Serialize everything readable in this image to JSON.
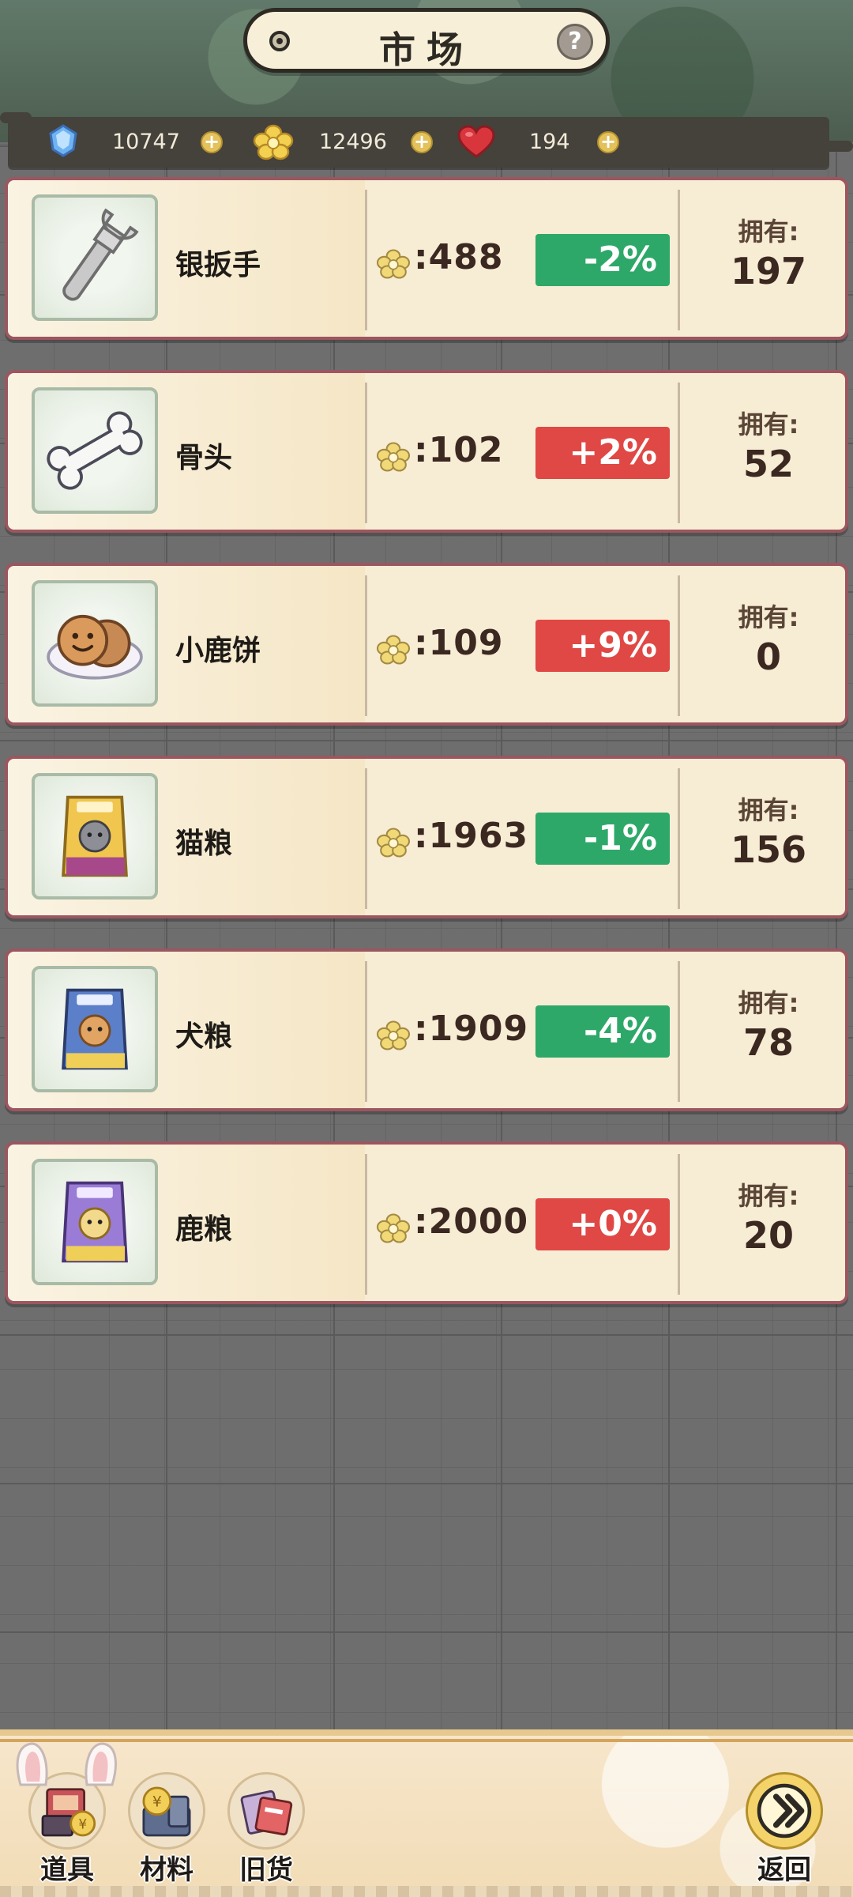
{
  "header": {
    "title": "市场",
    "help_label": "?"
  },
  "currencies": [
    {
      "icon": "blue-gem-icon",
      "value": "10747"
    },
    {
      "icon": "flower-coin-icon",
      "value": "12496"
    },
    {
      "icon": "heart-icon",
      "value": "194"
    }
  ],
  "items": [
    {
      "name": "银扳手",
      "icon": "silver-wrench-icon",
      "price": ":488",
      "change": "-2%",
      "direction": "down",
      "owned_label": "拥有:",
      "owned": "197"
    },
    {
      "name": "骨头",
      "icon": "bone-icon",
      "price": ":102",
      "change": "+2%",
      "direction": "up",
      "owned_label": "拥有:",
      "owned": "52"
    },
    {
      "name": "小鹿饼",
      "icon": "deer-cookie-icon",
      "price": ":109",
      "change": "+9%",
      "direction": "up",
      "owned_label": "拥有:",
      "owned": "0"
    },
    {
      "name": "猫粮",
      "icon": "cat-food-bag-icon",
      "price": ":1963",
      "change": "-1%",
      "direction": "down",
      "owned_label": "拥有:",
      "owned": "156"
    },
    {
      "name": "犬粮",
      "icon": "dog-food-bag-icon",
      "price": ":1909",
      "change": "-4%",
      "direction": "down",
      "owned_label": "拥有:",
      "owned": "78"
    },
    {
      "name": "鹿粮",
      "icon": "deer-food-bag-icon",
      "price": ":2000",
      "change": "+0%",
      "direction": "up",
      "owned_label": "拥有:",
      "owned": "20"
    }
  ],
  "bottom_tabs": [
    {
      "label": "道具",
      "icon": "props-tab-icon"
    },
    {
      "label": "材料",
      "icon": "materials-tab-icon"
    },
    {
      "label": "旧货",
      "icon": "second-hand-tab-icon"
    }
  ],
  "back_button": {
    "label": "返回",
    "icon": "arrow-return-icon"
  },
  "colors": {
    "price_down": "#2ea869",
    "price_up": "#e04845",
    "row_border": "#9c5660",
    "row_bg": "#f7ecd4"
  }
}
